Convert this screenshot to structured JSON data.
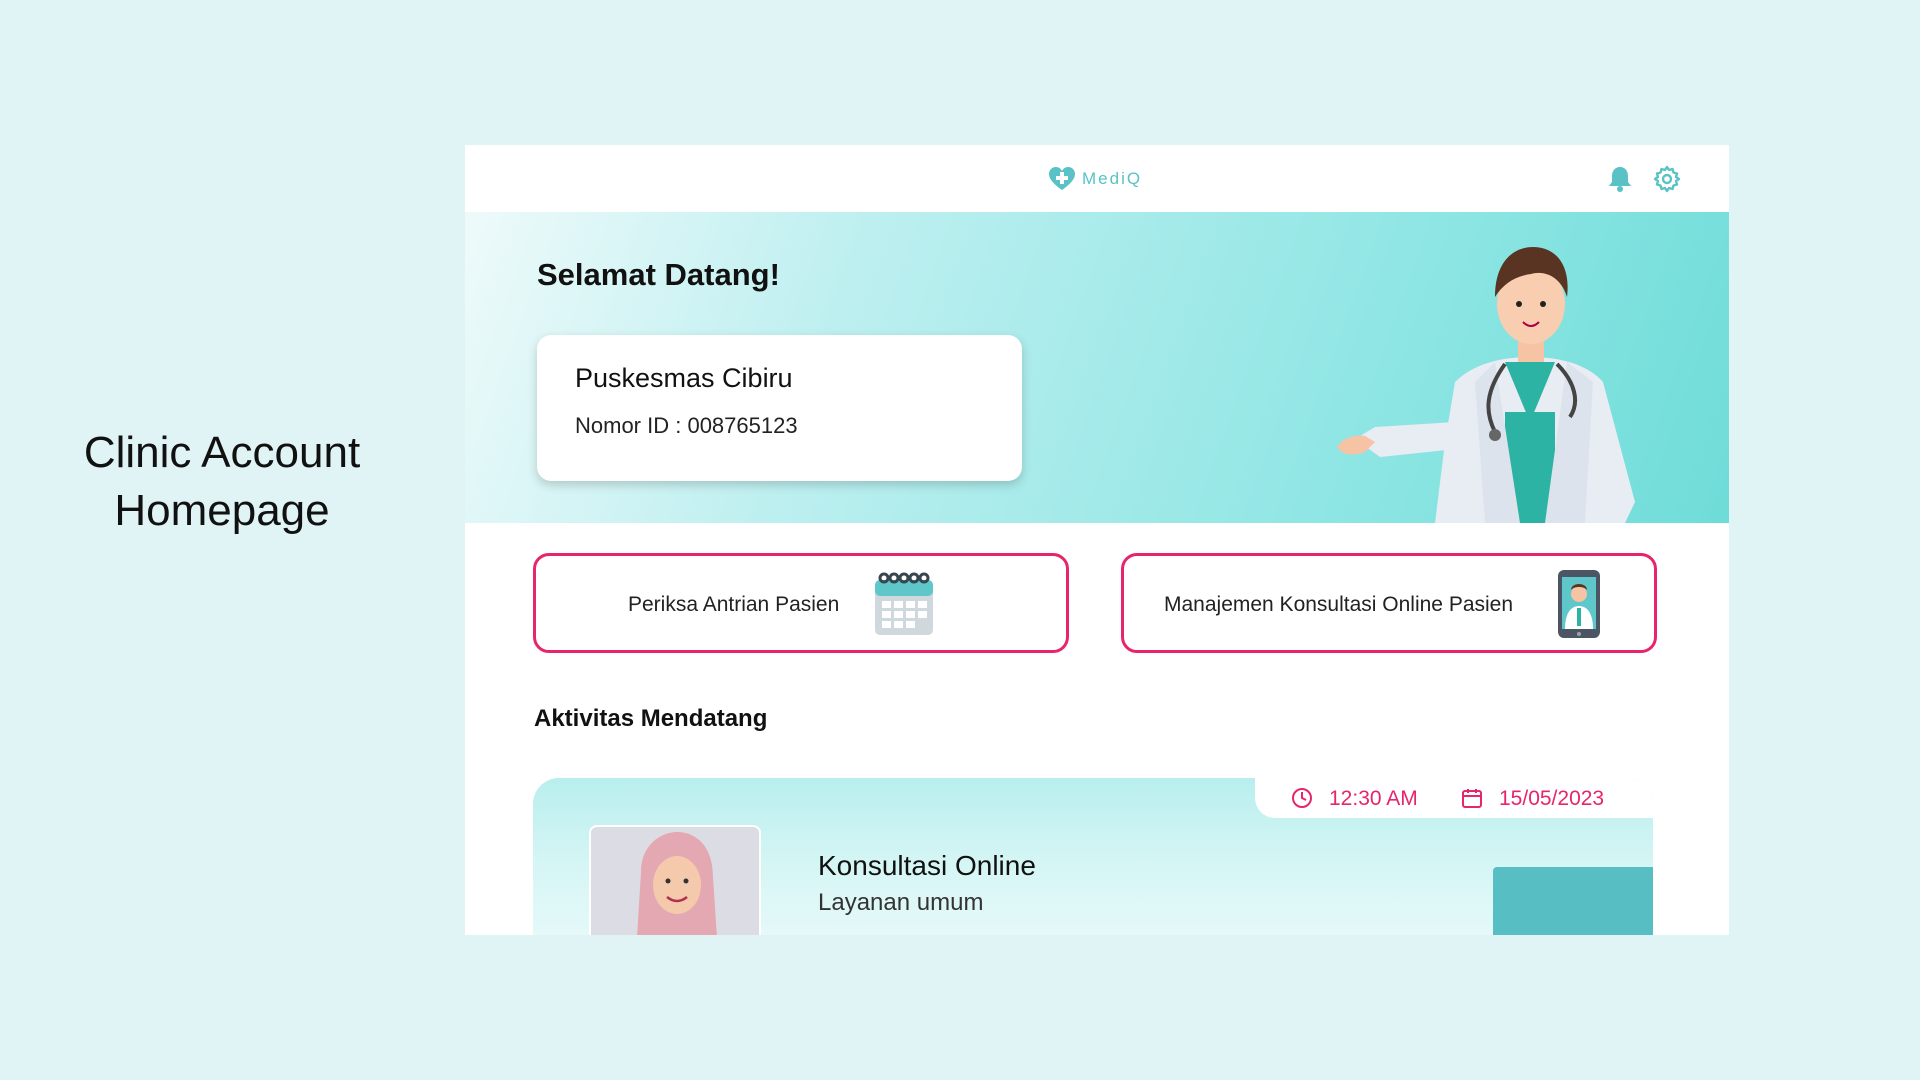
{
  "caption": {
    "line1": "Clinic Account",
    "line2": "Homepage"
  },
  "header": {
    "logo_text": "MediQ"
  },
  "hero": {
    "welcome": "Selamat Datang!",
    "clinic_name": "Puskesmas Cibiru",
    "clinic_id": "Nomor ID : 008765123"
  },
  "actions": [
    {
      "label": "Periksa Antrian Pasien",
      "icon": "calendar-icon"
    },
    {
      "label": "Manajemen Konsultasi Online Pasien",
      "icon": "phone-doctor-icon"
    }
  ],
  "upcoming": {
    "title": "Aktivitas Mendatang",
    "items": [
      {
        "time": "12:30 AM",
        "date": "15/05/2023",
        "title": "Konsultasi Online",
        "subtitle": "Layanan umum"
      }
    ]
  },
  "colors": {
    "accent": "#e6256c",
    "brand": "#58c2c6",
    "background": "#e0f4f6"
  }
}
